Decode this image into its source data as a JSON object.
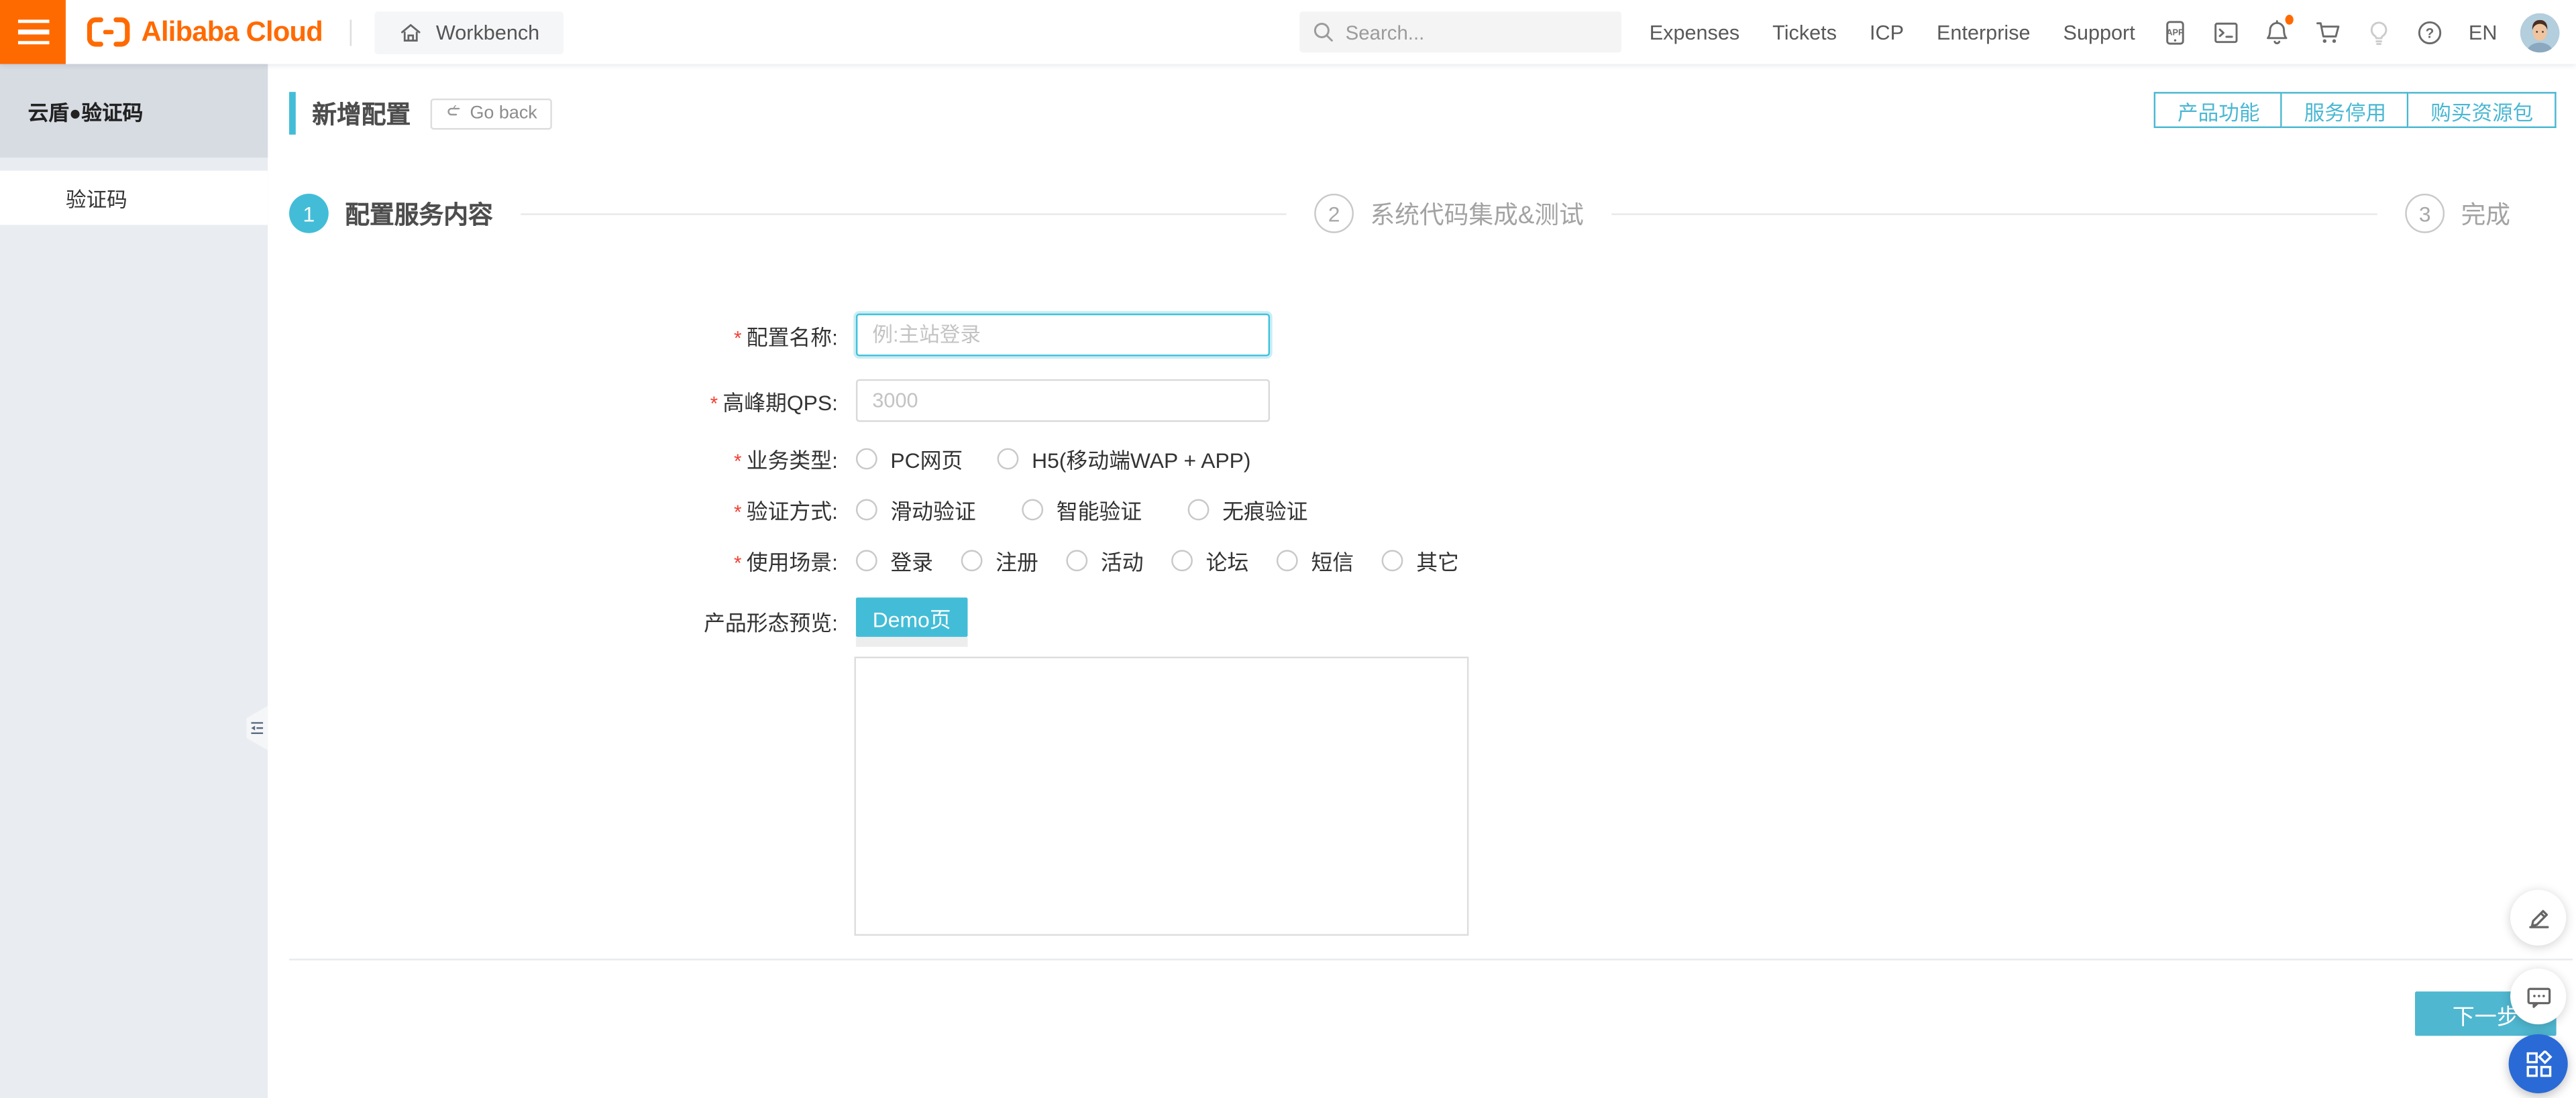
{
  "header": {
    "brand": "Alibaba Cloud",
    "workbench": "Workbench",
    "search_placeholder": "Search...",
    "nav": [
      "Expenses",
      "Tickets",
      "ICP",
      "Enterprise",
      "Support"
    ],
    "lang": "EN"
  },
  "sidebar": {
    "product_title": "云盾●验证码",
    "items": [
      {
        "label": "验证码",
        "active": true
      }
    ]
  },
  "page": {
    "title": "新增配置",
    "go_back": "Go back",
    "top_buttons": [
      "产品功能",
      "服务停用",
      "购买资源包"
    ],
    "steps": [
      {
        "num": "1",
        "label": "配置服务内容",
        "active": true
      },
      {
        "num": "2",
        "label": "系统代码集成&测试",
        "active": false
      },
      {
        "num": "3",
        "label": "完成",
        "active": false
      }
    ],
    "required_mark": "*",
    "form": {
      "rows": [
        {
          "required": true,
          "label": "配置名称:",
          "placeholder": "例:主站登录"
        },
        {
          "required": true,
          "label": "高峰期QPS:",
          "placeholder": "3000"
        },
        {
          "required": true,
          "label": "业务类型:",
          "options": [
            "PC网页",
            "H5(移动端WAP + APP)"
          ]
        },
        {
          "required": true,
          "label": "验证方式:",
          "options": [
            "滑动验证",
            "智能验证",
            "无痕验证"
          ]
        },
        {
          "required": true,
          "label": "使用场景:",
          "options": [
            "登录",
            "注册",
            "活动",
            "论坛",
            "短信",
            "其它"
          ]
        },
        {
          "required": false,
          "label": "产品形态预览:",
          "button": "Demo页"
        }
      ]
    },
    "next_button": "下一步"
  },
  "colors": {
    "accent_cyan": "#43bdd7",
    "brand_orange": "#ff6a00",
    "floating_blue": "#2a6ad6",
    "required_red": "#f04134"
  }
}
